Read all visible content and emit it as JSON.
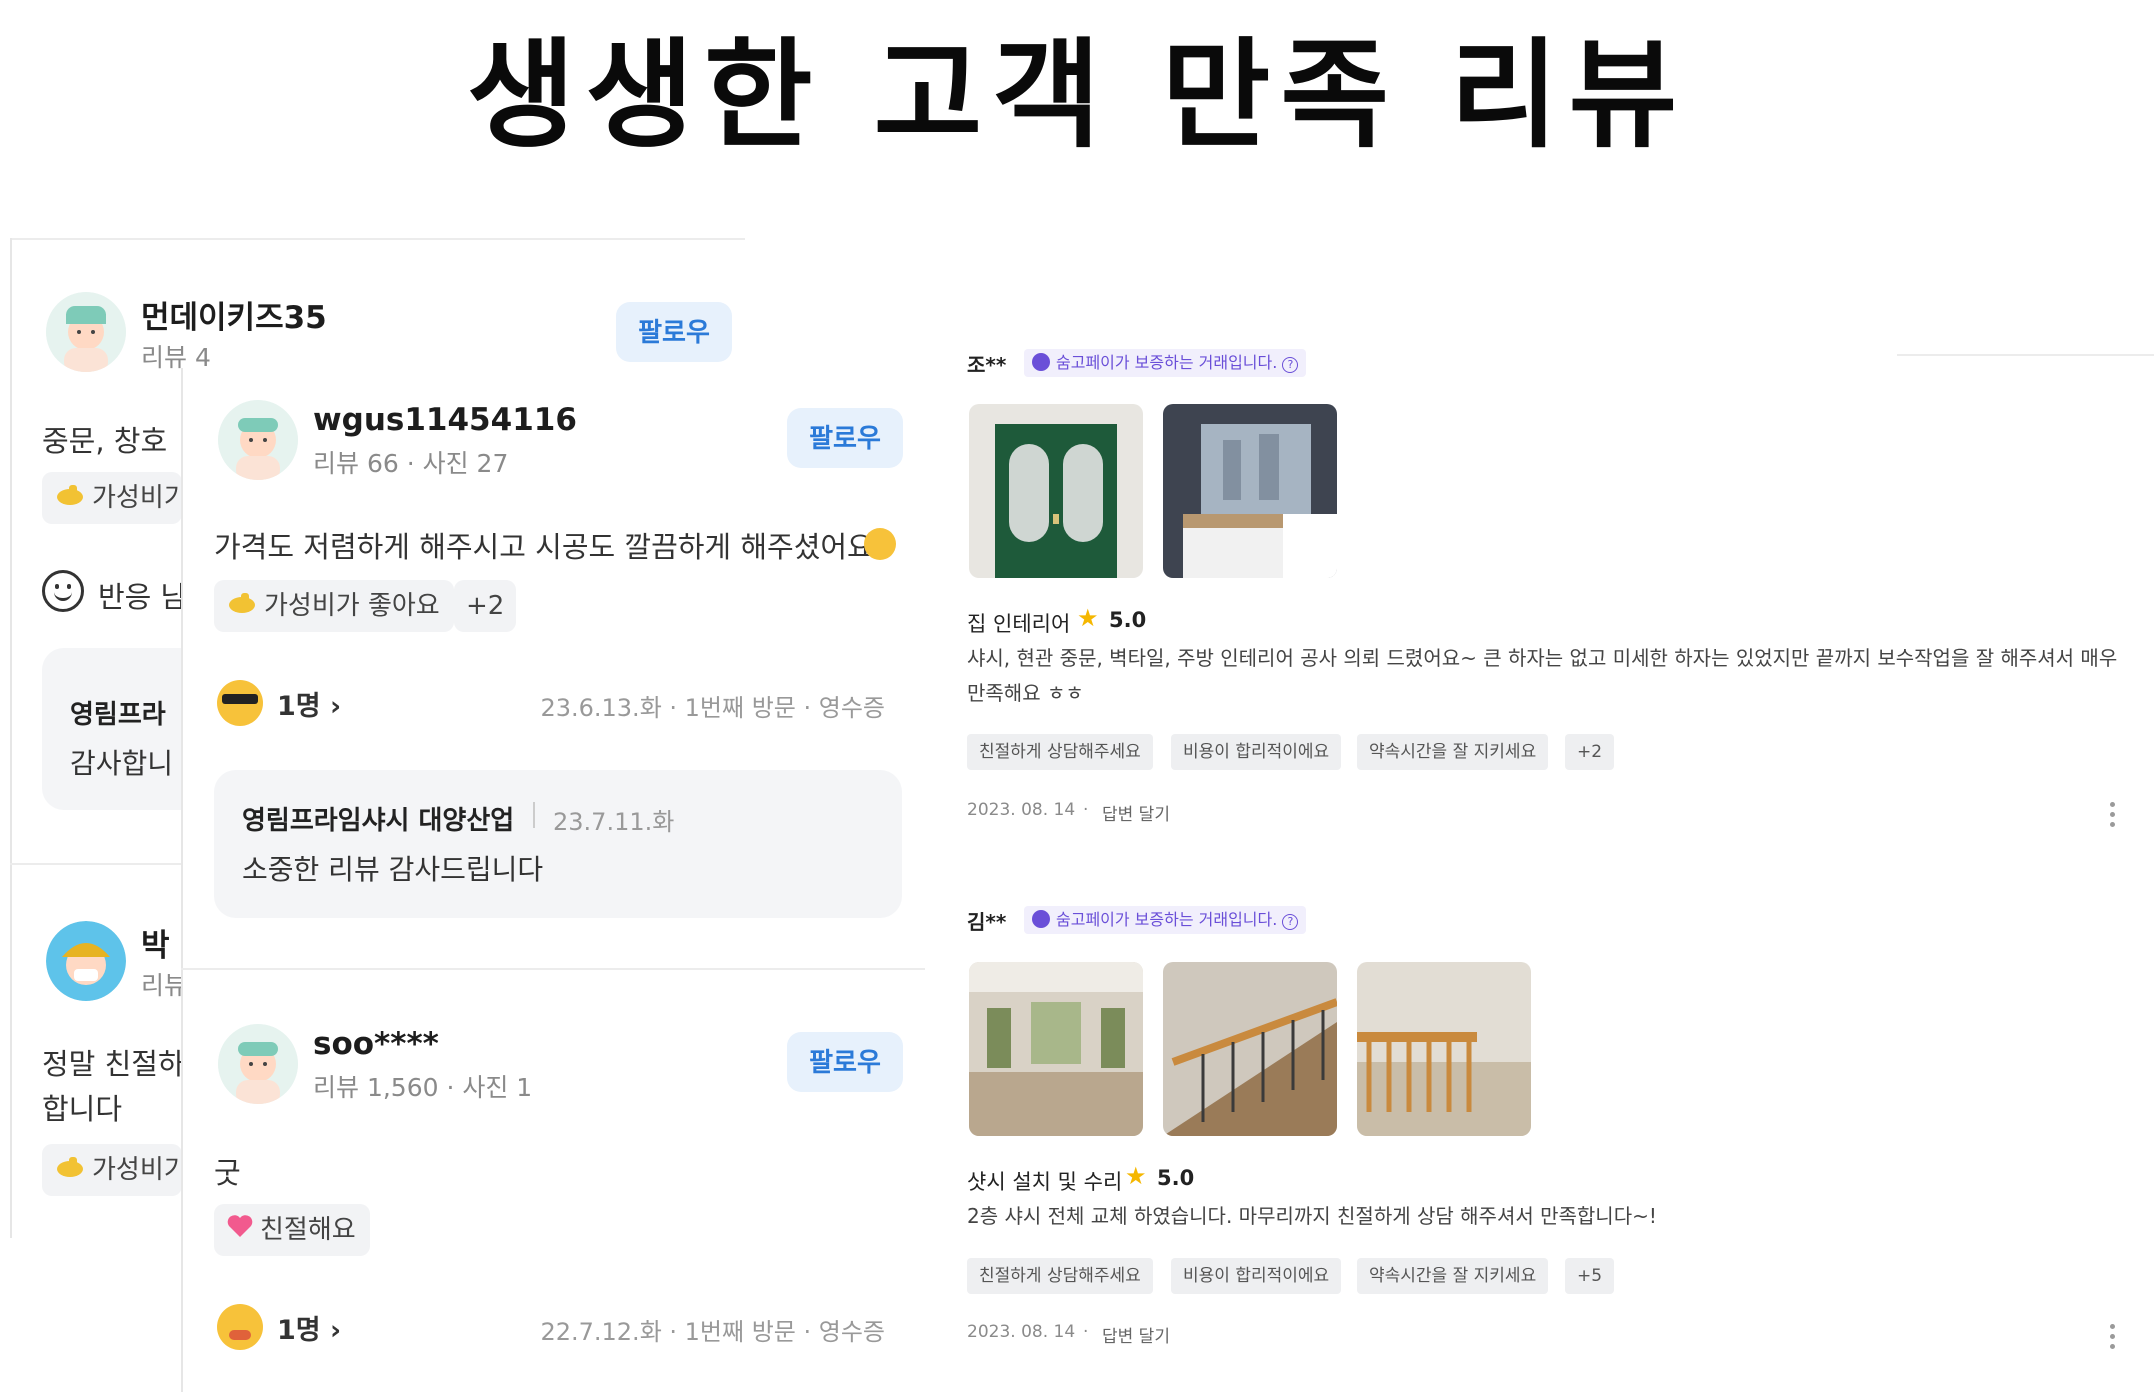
{
  "headline": "생생한 고객 만족 리뷰",
  "back_card": {
    "user_name": "먼데이키즈35",
    "user_meta": "리뷰 4",
    "follow_label": "팔로우",
    "category": "중문, 창호",
    "chip_label": "가성비기",
    "reaction_label": "반응 남",
    "reply_name": "영림프라",
    "reply_text": "감사합니",
    "second_user_name": "박",
    "second_user_meta": "리뷰",
    "second_text_line1": "정말 친절하",
    "second_text_line2": "합니다",
    "second_chip_label": "가성비기"
  },
  "mid_reviews": [
    {
      "user_name": "wgus11454116",
      "user_meta": "리뷰 66 · 사진 27",
      "follow_label": "팔로우",
      "text": "가격도 저렴하게 해주시고 시공도 깔끔하게 해주셨어요",
      "chip_label": "가성비가 좋아요",
      "more_chip": "+2",
      "reaction_count": "1명",
      "date_info": "23.6.13.화 · 1번째 방문 · 영수증",
      "reply": {
        "name": "영림프라임샤시 대양산업",
        "date": "23.7.11.화",
        "text": "소중한 리뷰 감사드립니다"
      }
    },
    {
      "user_name": "soo****",
      "user_meta": "리뷰 1,560 · 사진 1",
      "follow_label": "팔로우",
      "text": "굿",
      "chip_label": "친절해요",
      "reaction_count": "1명",
      "date_info": "22.7.12.화 · 1번째 방문 · 영수증"
    }
  ],
  "right_reviews": [
    {
      "name": "조**",
      "pay_badge": "숨고페이가 보증하는 거래입니다.",
      "service": "집 인테리어",
      "score": "5.0",
      "text": "샤시, 현관 중문, 벽타일, 주방 인테리어 공사 의뢰 드렸어요~ 큰 하자는 없고 미세한 하자는 있었지만 끝까지 보수작업을 잘 해주셔서 매우 만족해요 ㅎㅎ",
      "tags": [
        "친절하게 상담해주세요",
        "비용이 합리적이에요",
        "약속시간을 잘 지키세요",
        "+2"
      ],
      "date": "2023. 08. 14",
      "reply_label": "답변 달기"
    },
    {
      "name": "김**",
      "pay_badge": "숨고페이가 보증하는 거래입니다.",
      "service": "샷시 설치 및 수리",
      "score": "5.0",
      "text": "2층 샤시 전체 교체 하였습니다. 마무리까지 친절하게 상담 해주셔서 만족합니다~!",
      "tags": [
        "친절하게 상담해주세요",
        "비용이 합리적이에요",
        "약속시간을 잘 지키세요",
        "+5"
      ],
      "date": "2023. 08. 14",
      "reply_label": "답변 달기"
    }
  ],
  "colors": {
    "follow_bg": "#e7f1fc",
    "follow_text": "#2b7ad8",
    "pay_text": "#6a4fd8",
    "star": "#f5b700"
  },
  "icons": [
    "avatar-icon",
    "thumbs-up-icon",
    "smile-icon",
    "heart-icon",
    "cool-face-icon",
    "star-icon",
    "question-icon",
    "more-icon",
    "chevron-right-icon"
  ]
}
